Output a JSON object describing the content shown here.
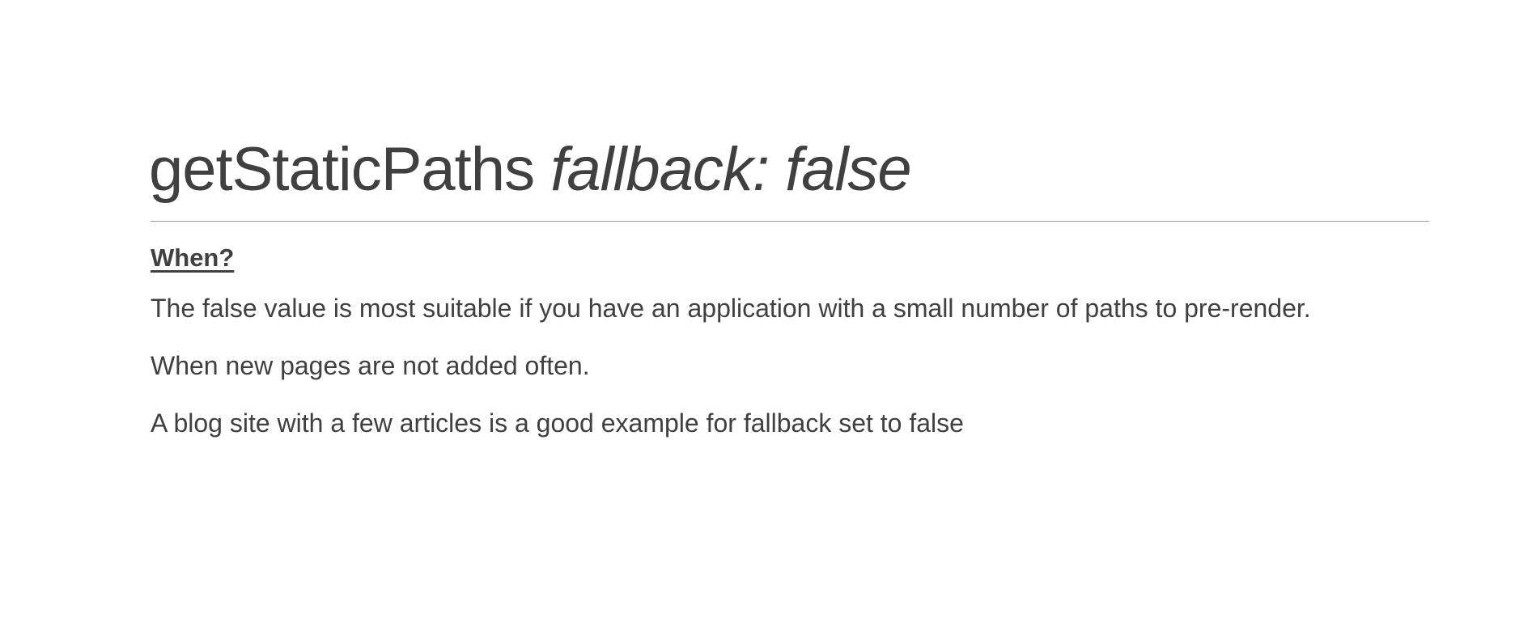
{
  "slide": {
    "title_plain": "getStaticPaths",
    "title_italic": "fallback: false",
    "heading": "When?",
    "paragraphs": [
      "The false value is most suitable if you have an application with a small number of paths to pre-render.",
      "When new pages are not added often.",
      "A blog site with a few articles is a good example for fallback set to false"
    ]
  }
}
